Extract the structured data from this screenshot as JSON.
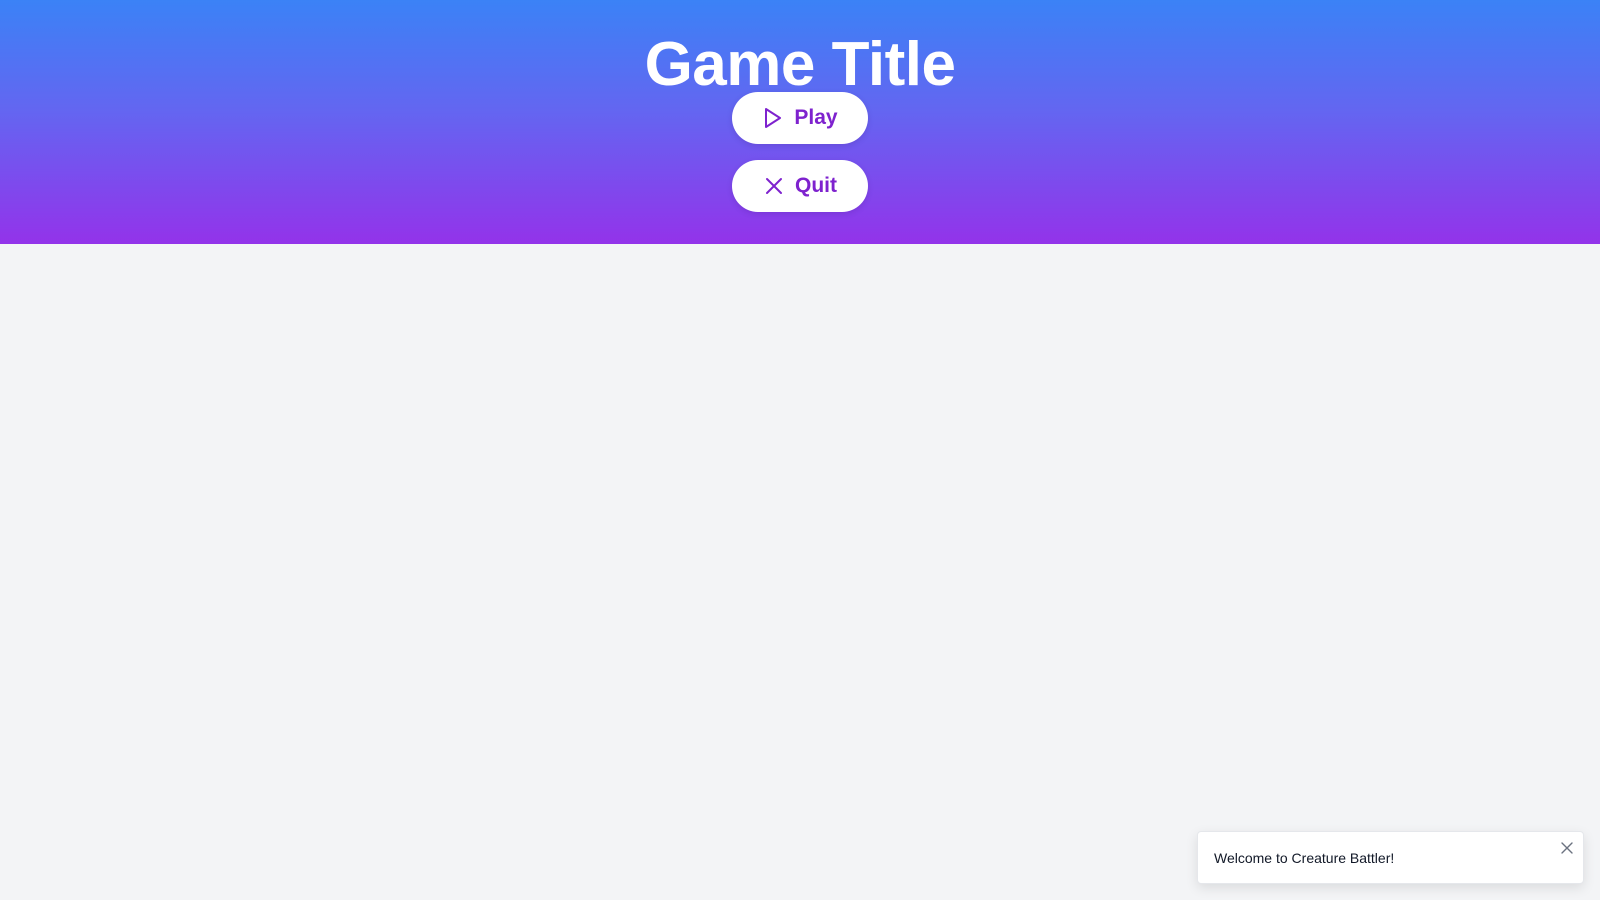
{
  "header": {
    "title": "Game Title",
    "gradient_top": "#3b82f6",
    "gradient_bottom": "#9333ea"
  },
  "menu": {
    "play": {
      "label": "Play",
      "icon": "play-icon"
    },
    "quit": {
      "label": "Quit",
      "icon": "close-icon"
    },
    "accent": "#7e22ce"
  },
  "toast": {
    "message": "Welcome to Creature Battler!",
    "close_icon": "close-icon"
  }
}
